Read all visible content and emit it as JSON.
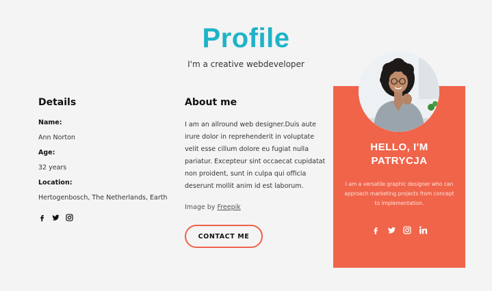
{
  "header": {
    "title": "Profile",
    "subtitle": "I'm a creative webdeveloper"
  },
  "details": {
    "heading": "Details",
    "name_label": "Name:",
    "name_value": "Ann Norton",
    "age_label": "Age:",
    "age_value": "32 years",
    "location_label": "Location:",
    "location_value": "Hertogenbosch, The Netherlands, Earth",
    "social_icons": [
      "facebook-icon",
      "twitter-icon",
      "instagram-icon"
    ]
  },
  "about": {
    "heading": "About me",
    "text": "I am an allround web designer.Duis aute irure dolor in reprehenderit in voluptate velit esse cillum dolore eu fugiat nulla pariatur. Excepteur sint occaecat cupidatat non proident, sunt in culpa qui officia deserunt mollit anim id est laborum.",
    "credit_prefix": "Image by ",
    "credit_link": "Freepik",
    "contact_label": "CONTACT ME"
  },
  "card": {
    "heading_line1": "HELLO, I'M",
    "heading_line2": "PATRYCJA",
    "text": "I am a versatile graphic designer who can approach marketing projects from concept to implementation.",
    "social_icons": [
      "facebook-icon",
      "twitter-icon",
      "instagram-icon",
      "linkedin-icon"
    ]
  },
  "colors": {
    "accent_teal": "#1fb3c8",
    "card_coral": "#f0644a",
    "button_border": "#f0604a",
    "background": "#f4f4f4"
  }
}
